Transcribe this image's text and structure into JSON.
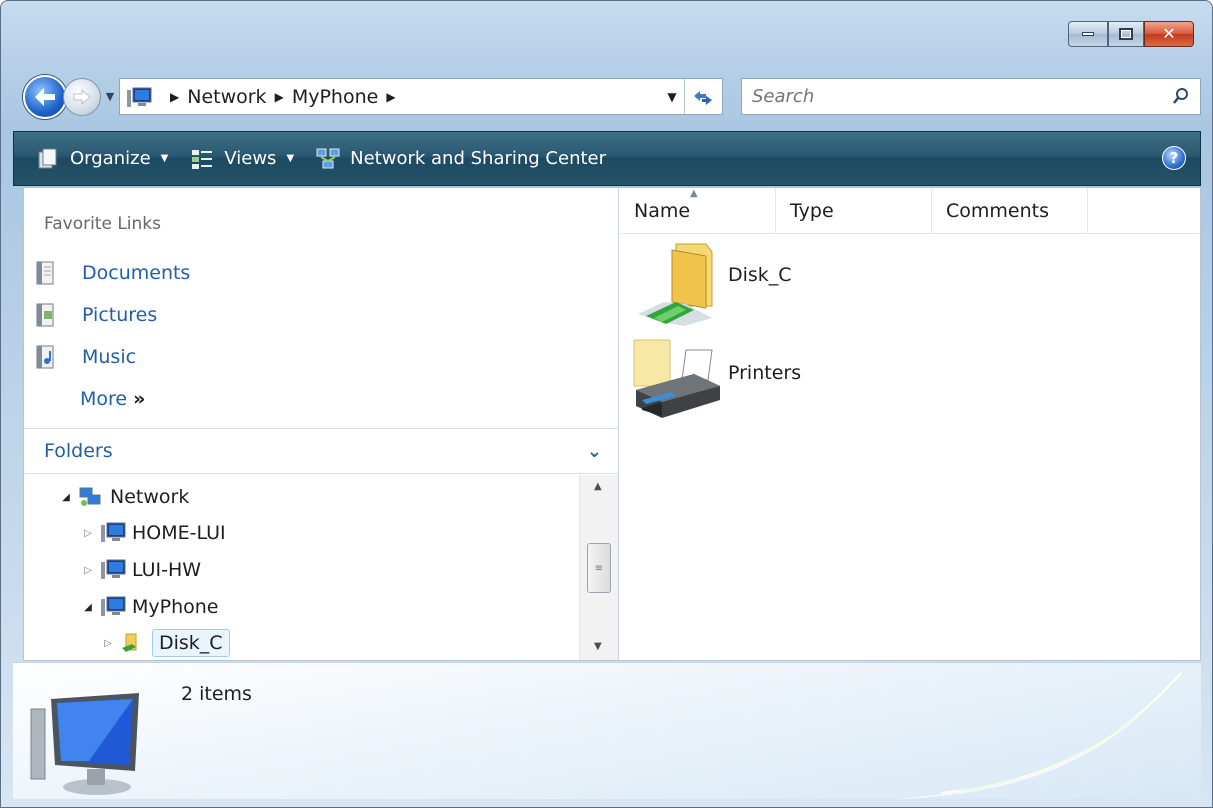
{
  "window": {
    "caption_buttons": [
      "minimize",
      "maximize",
      "close"
    ]
  },
  "address_bar": {
    "crumbs": [
      "Network",
      "MyPhone"
    ],
    "icon": "computer-icon"
  },
  "search": {
    "placeholder": "Search"
  },
  "command_bar": {
    "organize_label": "Organize",
    "views_label": "Views",
    "network_sharing_label": "Network and Sharing Center"
  },
  "favorite_links": {
    "title": "Favorite Links",
    "items": [
      {
        "label": "Documents",
        "icon": "documents-icon"
      },
      {
        "label": "Pictures",
        "icon": "pictures-icon"
      },
      {
        "label": "Music",
        "icon": "music-icon"
      }
    ],
    "more_label": "More",
    "more_chevron": "»"
  },
  "folders": {
    "title": "Folders",
    "tree": [
      {
        "label": "Network",
        "state": "expanded",
        "icon": "network-icon",
        "level": 0
      },
      {
        "label": "HOME-LUI",
        "state": "collapsed",
        "icon": "computer-icon",
        "level": 1
      },
      {
        "label": "LUI-HW",
        "state": "collapsed",
        "icon": "computer-icon",
        "level": 1
      },
      {
        "label": "MyPhone",
        "state": "expanded",
        "icon": "computer-icon",
        "level": 1
      },
      {
        "label": "Disk_C",
        "state": "collapsed",
        "icon": "shared-folder-icon",
        "level": 2,
        "selected": true
      }
    ]
  },
  "columns": [
    "Name",
    "Type",
    "Comments"
  ],
  "items": [
    {
      "label": "Disk_C",
      "icon": "network-folder-icon"
    },
    {
      "label": "Printers",
      "icon": "printer-icon"
    }
  ],
  "details": {
    "count_text": "2 items"
  },
  "colors": {
    "link_blue": "#1f5ea8",
    "command_bar": "#245467",
    "accent": "#2169c6"
  }
}
